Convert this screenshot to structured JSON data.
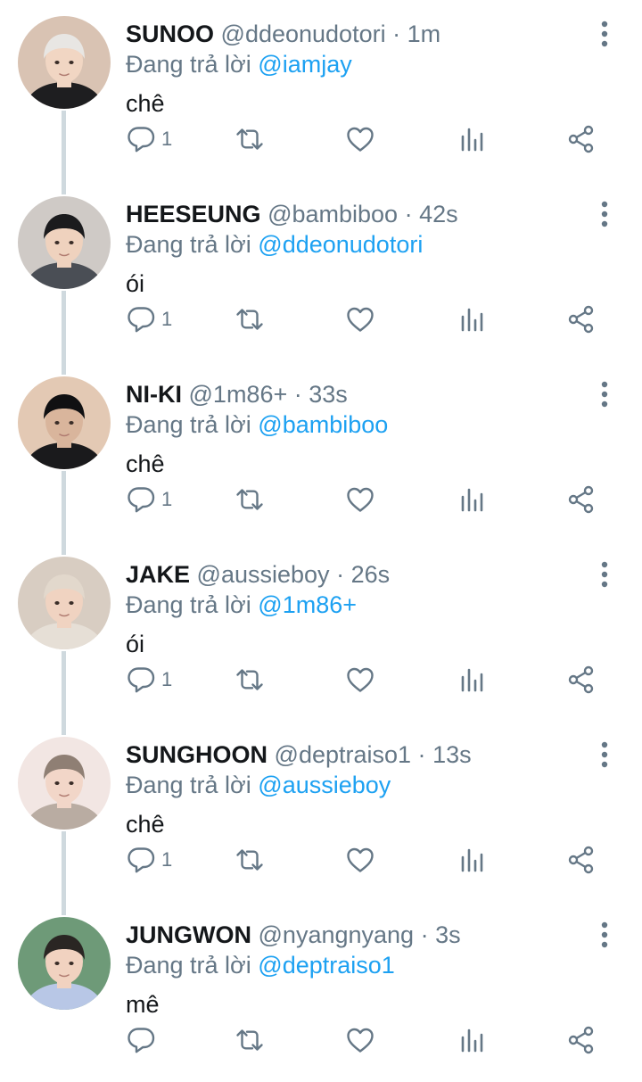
{
  "reply_prefix": "Đang trả lời",
  "tweets": [
    {
      "name": "SUNOO",
      "handle": "@ddeonudotori",
      "time": "1m",
      "reply_to": "@iamjay",
      "text": "chê",
      "reply_count": "1",
      "avatar_palette": {
        "bg": "#d9c3b3",
        "hair": "#e8e6e3",
        "face": "#f1d6c3",
        "shirt": "#1e1e20"
      }
    },
    {
      "name": "HEESEUNG",
      "handle": "@bambiboo",
      "time": "42s",
      "reply_to": "@ddeonudotori",
      "text": "ói",
      "reply_count": "1",
      "avatar_palette": {
        "bg": "#cfcac6",
        "hair": "#1b1b1d",
        "face": "#efd2be",
        "shirt": "#4a4e55"
      }
    },
    {
      "name": "NI-KI",
      "handle": "@1m86+",
      "time": "33s",
      "reply_to": "@bambiboo",
      "text": "chê",
      "reply_count": "1",
      "avatar_palette": {
        "bg": "#e3c9b4",
        "hair": "#101012",
        "face": "#d9b59c",
        "shirt": "#1a1a1c"
      }
    },
    {
      "name": "JAKE",
      "handle": "@aussieboy",
      "time": "26s",
      "reply_to": "@1m86+",
      "text": "ói",
      "reply_count": "1",
      "avatar_palette": {
        "bg": "#d8cdc2",
        "hair": "#e2d8cc",
        "face": "#f0d3c1",
        "shirt": "#e6dfd6"
      }
    },
    {
      "name": "SUNGHOON",
      "handle": "@deptraiso1",
      "time": "13s",
      "reply_to": "@aussieboy",
      "text": "chê",
      "reply_count": "1",
      "avatar_palette": {
        "bg": "#f2e6e3",
        "hair": "#8f7f74",
        "face": "#f2d6c8",
        "shirt": "#b9aca2"
      }
    },
    {
      "name": "JUNGWON",
      "handle": "@nyangnyang",
      "time": "3s",
      "reply_to": "@deptraiso1",
      "text": "mê",
      "reply_count": "",
      "avatar_palette": {
        "bg": "#6e9a78",
        "hair": "#2a2623",
        "face": "#f1d2c0",
        "shirt": "#b8c7e6"
      }
    }
  ],
  "icons": {
    "reply": "comment-bubble-icon",
    "retweet": "retweet-icon",
    "like": "heart-icon",
    "stats": "bar-chart-icon",
    "share": "share-icon",
    "more": "vertical-dots-icon"
  },
  "colors": {
    "text": "#14171a",
    "secondary": "#657786",
    "link": "#1da1f2",
    "thread_line": "#cfd9de"
  }
}
